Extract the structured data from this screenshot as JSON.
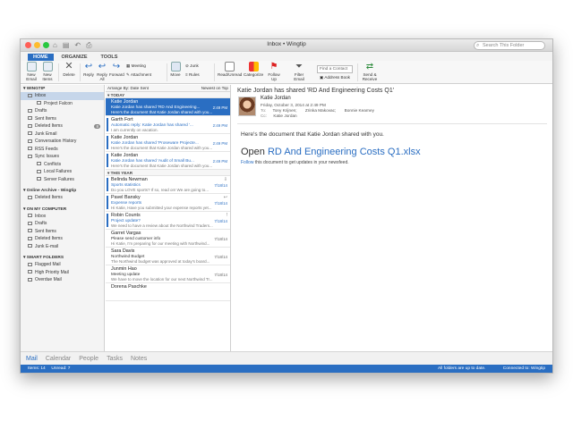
{
  "window": {
    "title": "Inbox • Wingtip",
    "search_placeholder": "Search This Folder"
  },
  "tabs": [
    {
      "label": "HOME",
      "active": true
    },
    {
      "label": "ORGANIZE"
    },
    {
      "label": "TOOLS"
    }
  ],
  "ribbon": {
    "new_email": "New Email",
    "new_items": "New Items",
    "delete": "Delete",
    "reply": "Reply",
    "reply_all": "Reply All",
    "forward": "Forward",
    "meeting": "Meeting",
    "attachment": "Attachment",
    "move": "Move",
    "junk": "Junk",
    "rules": "Rules",
    "read_unread": "Read/Unread",
    "categorize": "Categorize",
    "follow_up": "Follow Up",
    "filter_email": "Filter Email",
    "find_contact": "Find a Contact",
    "address_book": "Address Book",
    "send_receive": "Send & Receive"
  },
  "sidebar": {
    "account": "WINGTIP",
    "folders": [
      {
        "label": "Inbox",
        "selected": true,
        "indent": 1
      },
      {
        "label": "Project Falcon",
        "indent": 2
      },
      {
        "label": "Drafts",
        "indent": 1
      },
      {
        "label": "Sent Items",
        "indent": 1
      },
      {
        "label": "Deleted Items",
        "indent": 1,
        "badge": "8"
      },
      {
        "label": "Junk Email",
        "indent": 1
      },
      {
        "label": "Conversation History",
        "indent": 1
      },
      {
        "label": "RSS Feeds",
        "indent": 1
      },
      {
        "label": "Sync Issues",
        "indent": 1
      },
      {
        "label": "Conflicts",
        "indent": 2
      },
      {
        "label": "Local Failures",
        "indent": 2
      },
      {
        "label": "Server Failures",
        "indent": 2
      }
    ],
    "archive": "Online Archive - Wingtip",
    "archive_folders": [
      {
        "label": "Deleted Items",
        "indent": 1
      }
    ],
    "computer": "ON MY COMPUTER",
    "computer_folders": [
      {
        "label": "Inbox",
        "indent": 1
      },
      {
        "label": "Drafts",
        "indent": 1
      },
      {
        "label": "Sent Items",
        "indent": 1
      },
      {
        "label": "Deleted Items",
        "indent": 1
      },
      {
        "label": "Junk E-mail",
        "indent": 1
      }
    ],
    "smart": "SMART FOLDERS",
    "smart_folders": [
      {
        "label": "Flagged Mail",
        "indent": 1
      },
      {
        "label": "High Priority Mail",
        "indent": 1
      },
      {
        "label": "Overdue Mail",
        "indent": 1
      }
    ]
  },
  "list": {
    "arrange": "Arrange By: Date Sent",
    "order": "Newest on Top",
    "group_today": "TODAY",
    "today": [
      {
        "from": "Katie Jordan",
        "subject": "Katie Jordan has shared 'RD And Engineering...",
        "preview": "Here's the document that Katie Jordan shared with you...",
        "time": "2:49 PM",
        "selected": true,
        "unread": true
      },
      {
        "from": "Garth Fort",
        "subject": "Automatic reply: Katie Jordan has shared '...",
        "preview": "I am currently on vacation.",
        "time": "2:49 PM",
        "unread": true
      },
      {
        "from": "Katie Jordan",
        "subject": "Katie Jordan has shared 'Proseware Projecte...",
        "preview": "Here's the document that Katie Jordan shared with you...",
        "time": "2:49 PM",
        "unread": true
      },
      {
        "from": "Katie Jordan",
        "subject": "Katie Jordan has shared 'Audit of Small Bu...",
        "preview": "Here's the document that Katie Jordan shared with you...",
        "time": "2:49 PM",
        "unread": true
      }
    ],
    "group_year": "THIS YEAR",
    "year": [
      {
        "from": "Belinda Newman",
        "subject": "Sports statistics",
        "preview": "Do you LOVE sports? If so, read on! We are going to...",
        "time": "7/18/14",
        "unread": true,
        "flag": "⇩"
      },
      {
        "from": "Pavel Bansky",
        "subject": "Expense reports",
        "preview": "Hi Katie, Have you submitted your expense reports yet...",
        "time": "7/18/14",
        "unread": true,
        "flag": "↩"
      },
      {
        "from": "Robin Counts",
        "subject": "Project update?",
        "preview": "We need to have a review about the Northwind Traders...",
        "time": "7/18/14",
        "unread": true,
        "flag": "!"
      },
      {
        "from": "Garret Vargas",
        "subject": "Please send customer info",
        "preview": "Hi Katie, I'm preparing for our meeting with Northwind...",
        "time": "7/18/14",
        "read": true
      },
      {
        "from": "Sara Davis",
        "subject": "Northwind Budget",
        "preview": "The Northwind budget was approved at today's board...",
        "time": "7/18/14",
        "read": true
      },
      {
        "from": "Junmin Hao",
        "subject": "Meeting update",
        "preview": "We have to move the location for our next Northwind Tr...",
        "time": "7/18/14",
        "read": true
      },
      {
        "from": "Dorena Paschke",
        "subject": "",
        "preview": "",
        "time": "",
        "read": true
      }
    ]
  },
  "reading": {
    "subject": "Katie Jordan has shared 'RD And Engineering Costs Q1'",
    "from": "Katie Jordan",
    "date": "Friday, October 3, 2014 at 2:49 PM",
    "to_label": "To:",
    "to": [
      "Tony Krijnen;",
      "Zrinka Makovac;",
      "Bonnie Kearney"
    ],
    "cc_label": "Cc:",
    "cc": "Katie Jordan",
    "body_intro": "Here's the document that Katie Jordan shared with you.",
    "open_word": "Open",
    "doc_link": "RD And Engineering Costs Q1.xlsx",
    "follow_link": "Follow",
    "follow_rest": "this document to get updates in your newsfeed."
  },
  "nav": [
    {
      "label": "Mail",
      "active": true
    },
    {
      "label": "Calendar"
    },
    {
      "label": "People"
    },
    {
      "label": "Tasks"
    },
    {
      "label": "Notes"
    }
  ],
  "status": {
    "items": "Items: 14",
    "unread": "Unread: 7",
    "sync": "All folders are up to date.",
    "connected": "Connected to: Wingtip"
  },
  "colors": {
    "accent": "#2a6ec2",
    "red_light": "#ff5f57",
    "yellow_light": "#febc2e",
    "green_light": "#28c840"
  }
}
